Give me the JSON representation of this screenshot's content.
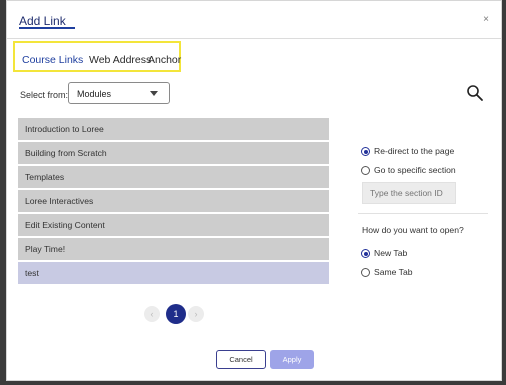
{
  "dialog": {
    "title": "Add Link",
    "close_glyph": "×"
  },
  "tabs": [
    {
      "label": "Course Links",
      "active": true
    },
    {
      "label": "Web Address",
      "active": false
    },
    {
      "label": "Anchor",
      "active": false
    }
  ],
  "select": {
    "label": "Select from:",
    "value": "Modules"
  },
  "search_icon": "search-icon",
  "modules": [
    {
      "label": "Introduction to Loree",
      "selected": false
    },
    {
      "label": "Building from Scratch",
      "selected": false
    },
    {
      "label": "Templates",
      "selected": false
    },
    {
      "label": "Loree Interactives",
      "selected": false
    },
    {
      "label": "Edit Existing Content",
      "selected": false
    },
    {
      "label": "Play Time!",
      "selected": false
    },
    {
      "label": "test",
      "selected": true
    }
  ],
  "redirect": {
    "option_page": "Re-direct to the page",
    "option_section": "Go to specific section",
    "section_placeholder": "Type the section ID",
    "selected": "page"
  },
  "open_mode": {
    "question": "How do you want to open?",
    "option_new": "New Tab",
    "option_same": "Same Tab",
    "selected": "new"
  },
  "pagination": {
    "prev_glyph": "‹",
    "current_page": "1",
    "next_glyph": "›"
  },
  "buttons": {
    "cancel": "Cancel",
    "apply": "Apply"
  },
  "colors": {
    "accent": "#1f2d8a",
    "highlight_box": "#f3e53a",
    "apply_button": "#9ea4e8",
    "list_item": "#cdcdcd",
    "list_item_selected": "#c8cae3"
  }
}
